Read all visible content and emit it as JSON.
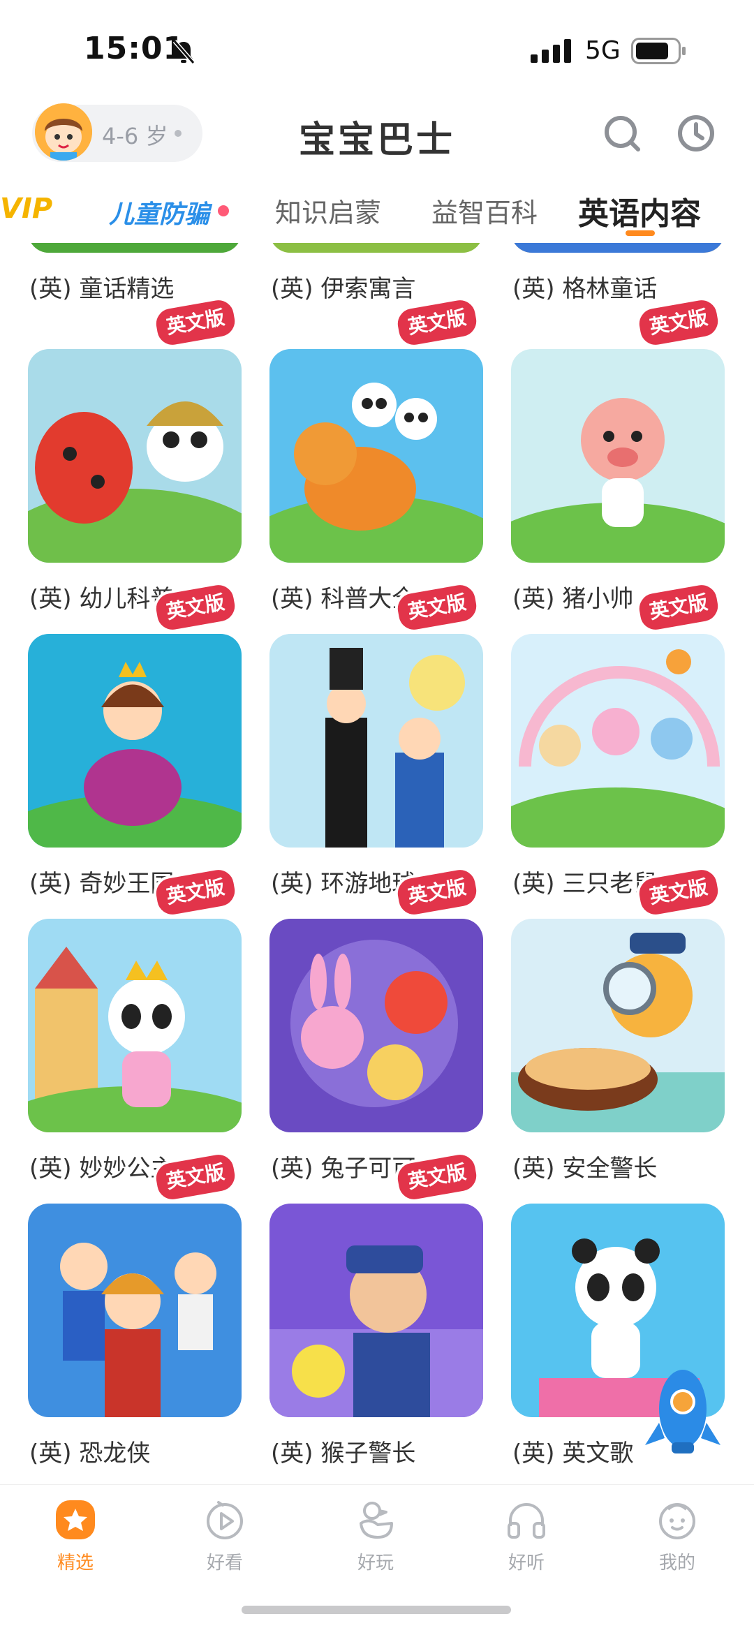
{
  "status_bar": {
    "time": "15:01",
    "network": "5G"
  },
  "header": {
    "age_label": "4-6 岁",
    "title": "宝宝巴士"
  },
  "tabs": [
    {
      "label": "VIP"
    },
    {
      "label": "儿童防骗"
    },
    {
      "label": "知识启蒙"
    },
    {
      "label": "益智百科"
    },
    {
      "label": "英语内容",
      "active": true
    }
  ],
  "badge_text": "英文版",
  "items": [
    {
      "title": "(英) 童话精选"
    },
    {
      "title": "(英) 伊索寓言"
    },
    {
      "title": "(英) 格林童话"
    },
    {
      "title": "(英) 幼儿科普"
    },
    {
      "title": "(英) 科普大全"
    },
    {
      "title": "(英) 猪小帅"
    },
    {
      "title": "(英) 奇妙王国"
    },
    {
      "title": "(英) 环游地球"
    },
    {
      "title": "(英) 三只老鼠"
    },
    {
      "title": "(英) 妙妙公主"
    },
    {
      "title": "(英) 兔子可可"
    },
    {
      "title": "(英) 安全警长"
    },
    {
      "title": "(英) 恐龙侠"
    },
    {
      "title": "(英) 猴子警长"
    },
    {
      "title": "(英) 英文歌"
    }
  ],
  "bottom_nav": [
    {
      "label": "精选",
      "icon": "star-icon",
      "active": true
    },
    {
      "label": "好看",
      "icon": "play-icon"
    },
    {
      "label": "好玩",
      "icon": "duck-icon"
    },
    {
      "label": "好听",
      "icon": "headphones-icon"
    },
    {
      "label": "我的",
      "icon": "face-icon"
    }
  ],
  "colors": {
    "accent": "#ff8a1e",
    "badge": "#e2344a",
    "vip": "#f5b400",
    "fraud": "#2b8fe8"
  }
}
